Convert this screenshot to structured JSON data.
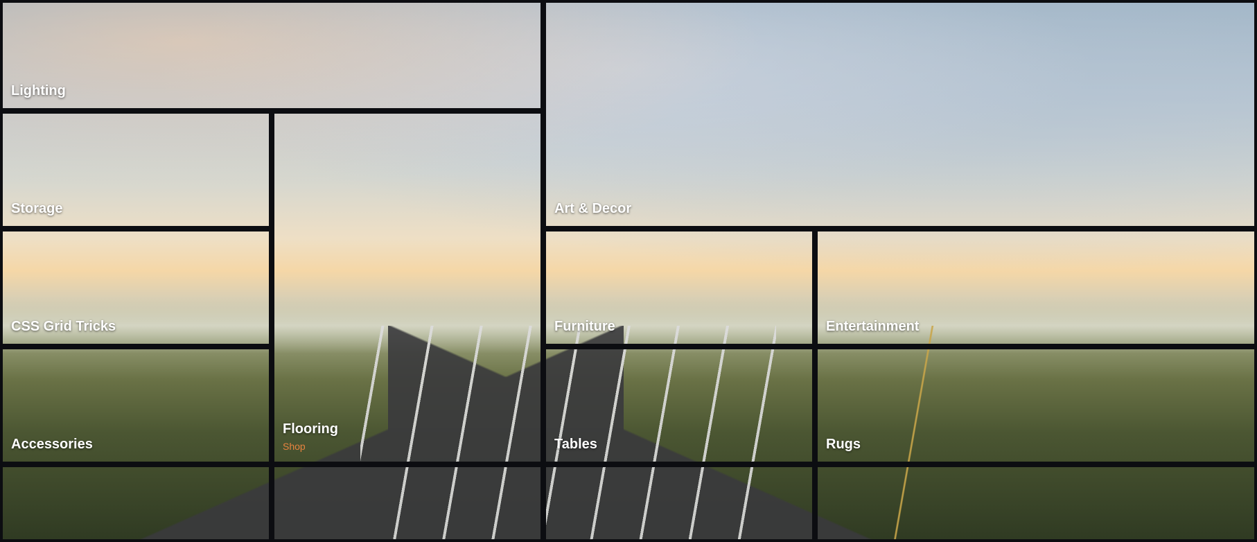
{
  "tiles": {
    "lighting": {
      "label": "Lighting"
    },
    "storage": {
      "label": "Storage"
    },
    "cssgrid": {
      "label": "CSS Grid Tricks"
    },
    "accessories": {
      "label": "Accessories"
    },
    "flooring": {
      "label": "Flooring",
      "sub": "Shop"
    },
    "artdecor": {
      "label": "Art & Decor"
    },
    "furniture": {
      "label": "Furniture"
    },
    "entertainment": {
      "label": "Entertainment"
    },
    "tables": {
      "label": "Tables"
    },
    "rugs": {
      "label": "Rugs"
    }
  }
}
